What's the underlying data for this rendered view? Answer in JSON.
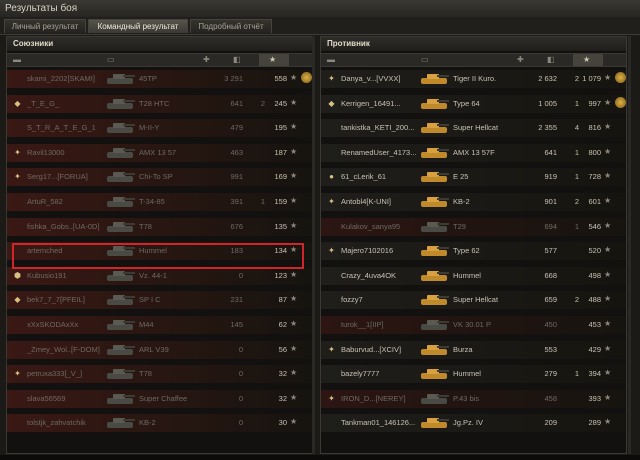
{
  "window": {
    "title": "Результаты боя"
  },
  "tabs": [
    {
      "label": "Личный результат",
      "active": false
    },
    {
      "label": "Командный результат",
      "active": true
    },
    {
      "label": "Подробный отчёт",
      "active": false
    }
  ],
  "colors": {
    "highlight": "#d0252a",
    "allyRowBg": "#3a1814",
    "enemyRowBg": "#1f1e1b",
    "deadText": "#6e6a60"
  },
  "allies": {
    "title": "Союзники",
    "rows": [
      {
        "player": "skami_2202[SKAMI]",
        "tank": "45TP",
        "c1": "3 291",
        "c2": "",
        "c3": "558",
        "dead": true,
        "medal": true,
        "badge": ""
      },
      {
        "player": "_T_E_G_",
        "tank": "T28 HTC",
        "c1": "641",
        "c2": "2",
        "c3": "245",
        "dead": true,
        "medal": false,
        "badge": "◆"
      },
      {
        "player": "S_T_R_A_T_E_G_1",
        "tank": "M-II-Y",
        "c1": "479",
        "c2": "",
        "c3": "195",
        "dead": true,
        "medal": false,
        "badge": ""
      },
      {
        "player": "Ravil13000",
        "tank": "AMX 13 57",
        "c1": "463",
        "c2": "",
        "c3": "187",
        "dead": true,
        "medal": false,
        "badge": "✦"
      },
      {
        "player": "Serg17...[FORUA]",
        "tank": "Chi-To SP",
        "c1": "991",
        "c2": "",
        "c3": "169",
        "dead": true,
        "medal": false,
        "badge": "✦"
      },
      {
        "player": "ArtuR_582",
        "tank": "T-34-85",
        "c1": "391",
        "c2": "1",
        "c3": "159",
        "dead": true,
        "medal": false,
        "badge": ""
      },
      {
        "player": "fishka_Gobs..[UA-0D]",
        "tank": "T78",
        "c1": "676",
        "c2": "",
        "c3": "135",
        "dead": true,
        "medal": false,
        "badge": ""
      },
      {
        "player": "artemched",
        "tank": "Hummel",
        "c1": "183",
        "c2": "",
        "c3": "134",
        "dead": true,
        "medal": false,
        "badge": ""
      },
      {
        "player": "Kubusio191",
        "tank": "Vz. 44-1",
        "c1": "0",
        "c2": "",
        "c3": "123",
        "dead": true,
        "medal": false,
        "badge": "⬢"
      },
      {
        "player": "bek7_7_7[PFEIL]",
        "tank": "SP I C",
        "c1": "231",
        "c2": "",
        "c3": "87",
        "dead": true,
        "medal": false,
        "badge": "◆"
      },
      {
        "player": "xXxSKODAxXx",
        "tank": "M44",
        "c1": "145",
        "c2": "",
        "c3": "62",
        "dead": true,
        "medal": false,
        "badge": ""
      },
      {
        "player": "_Zmey_Wol..[F-DOM]",
        "tank": "ARL V39",
        "c1": "0",
        "c2": "",
        "c3": "56",
        "dead": true,
        "medal": false,
        "badge": ""
      },
      {
        "player": "petruxa333[_V_]",
        "tank": "T78",
        "c1": "0",
        "c2": "",
        "c3": "32",
        "dead": true,
        "medal": false,
        "badge": "✦"
      },
      {
        "player": "slava56569",
        "tank": "Super Chaffee",
        "c1": "0",
        "c2": "",
        "c3": "32",
        "dead": true,
        "medal": false,
        "badge": ""
      },
      {
        "player": "tolstjk_zahvatchik",
        "tank": "KB-2",
        "c1": "0",
        "c2": "",
        "c3": "30",
        "dead": true,
        "medal": false,
        "badge": ""
      }
    ]
  },
  "enemies": {
    "title": "Противник",
    "rows": [
      {
        "player": "Danya_v...[VVXX]",
        "tank": "Tiger II Kuro.",
        "c1": "2 632",
        "c2": "2",
        "c3": "1 079",
        "dead": false,
        "medal": true,
        "badge": "✦"
      },
      {
        "player": "Kerrigen_16491...",
        "tank": "Type 64",
        "c1": "1 005",
        "c2": "1",
        "c3": "997",
        "dead": false,
        "medal": true,
        "badge": "◆"
      },
      {
        "player": "tankistka_KETI_200...",
        "tank": "Super Hellcat",
        "c1": "2 355",
        "c2": "4",
        "c3": "816",
        "dead": false,
        "medal": false,
        "badge": ""
      },
      {
        "player": "RenamedUser_4173...",
        "tank": "AMX 13 57F",
        "c1": "641",
        "c2": "1",
        "c3": "800",
        "dead": false,
        "medal": false,
        "badge": ""
      },
      {
        "player": "61_cLerik_61",
        "tank": "E 25",
        "c1": "919",
        "c2": "1",
        "c3": "728",
        "dead": false,
        "medal": false,
        "badge": "●"
      },
      {
        "player": "Antobl4[K-UNI]",
        "tank": "KB-2",
        "c1": "901",
        "c2": "2",
        "c3": "601",
        "dead": false,
        "medal": false,
        "badge": "✦"
      },
      {
        "player": "Kulakov_sanya95",
        "tank": "T29",
        "c1": "694",
        "c2": "1",
        "c3": "546",
        "dead": true,
        "medal": false,
        "badge": ""
      },
      {
        "player": "Majero7102016",
        "tank": "Type 62",
        "c1": "577",
        "c2": "",
        "c3": "520",
        "dead": false,
        "medal": false,
        "badge": "✦"
      },
      {
        "player": "Crazy_4uva4OK",
        "tank": "Hummel",
        "c1": "668",
        "c2": "",
        "c3": "498",
        "dead": false,
        "medal": false,
        "badge": ""
      },
      {
        "player": "fozzy7",
        "tank": "Super Hellcat",
        "c1": "659",
        "c2": "2",
        "c3": "488",
        "dead": false,
        "medal": false,
        "badge": ""
      },
      {
        "player": "turok__1[IIP]",
        "tank": "VK 30.01 P",
        "c1": "450",
        "c2": "",
        "c3": "453",
        "dead": true,
        "medal": false,
        "badge": ""
      },
      {
        "player": "Baburvud...[XCIV]",
        "tank": "Burza",
        "c1": "553",
        "c2": "",
        "c3": "429",
        "dead": false,
        "medal": false,
        "badge": "✦"
      },
      {
        "player": "bazely7777",
        "tank": "Hummel",
        "c1": "279",
        "c2": "1",
        "c3": "394",
        "dead": false,
        "medal": false,
        "badge": ""
      },
      {
        "player": "IRON_D...[NEREY]",
        "tank": "P.43 bis",
        "c1": "458",
        "c2": "",
        "c3": "393",
        "dead": true,
        "medal": false,
        "badge": "✦"
      },
      {
        "player": "Tankman01_146126...",
        "tank": "Jg.Pz. IV",
        "c1": "209",
        "c2": "",
        "c3": "289",
        "dead": false,
        "medal": false,
        "badge": ""
      }
    ]
  },
  "icons": {
    "star": "★",
    "column_icons": [
      "tier-icon",
      "player-icon",
      "tank-icon",
      "damage-icon",
      "kills-icon",
      "xp-icon"
    ]
  }
}
